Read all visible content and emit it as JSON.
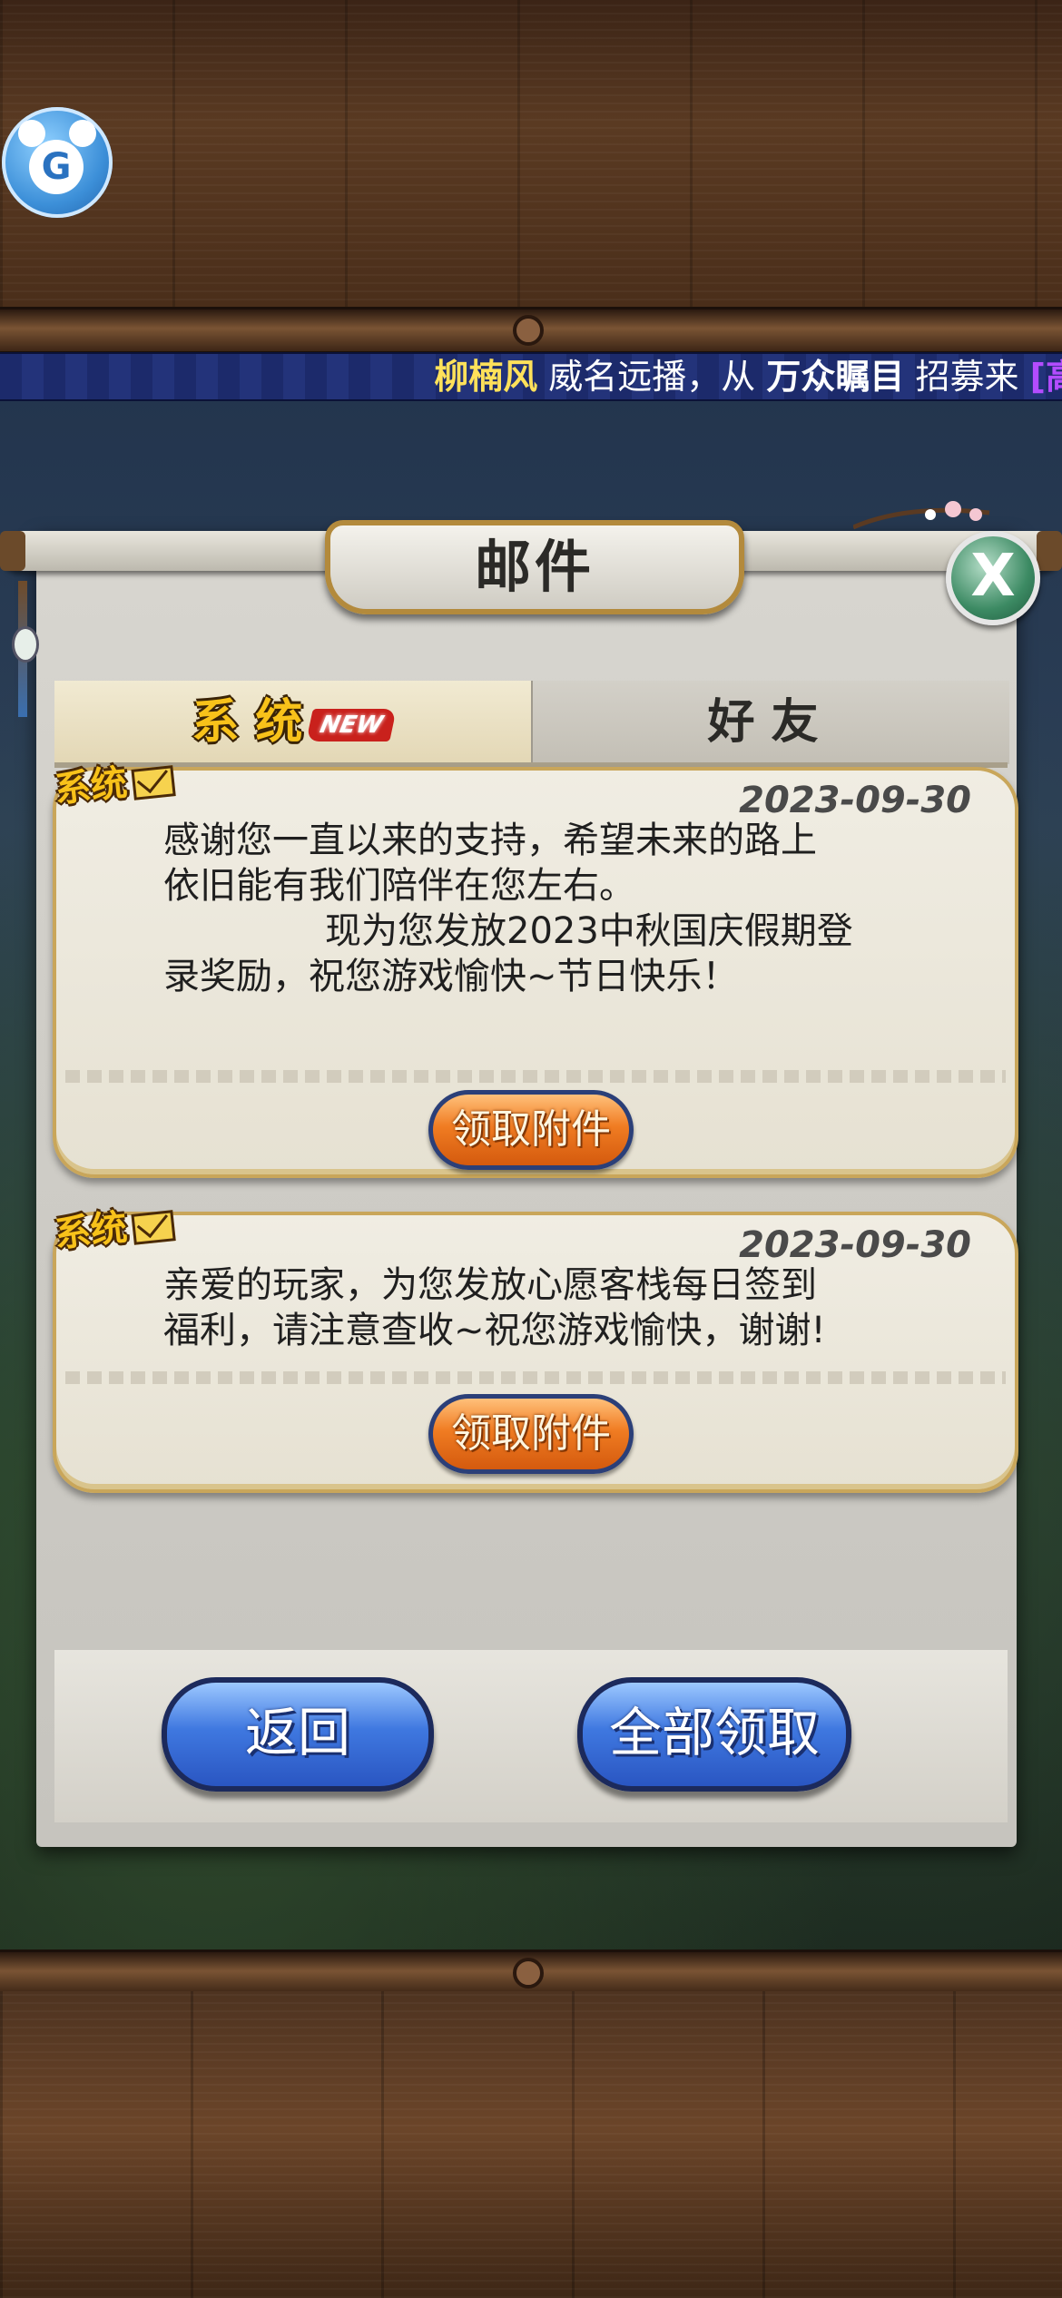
{
  "marquee": {
    "name": "柳楠风",
    "text1": "威名远播，从",
    "place": "万众瞩目",
    "text2": "招募来",
    "tail": "[高"
  },
  "logo": {
    "glyph": "G"
  },
  "window": {
    "title": "邮件",
    "close_glyph": "X"
  },
  "tabs": [
    {
      "label": "系统",
      "badge": "NEW",
      "active": true
    },
    {
      "label": "好友",
      "active": false
    }
  ],
  "mails": [
    {
      "tag": "系统",
      "date": "2023-09-30",
      "body": "感谢您一直以来的支持，希望未来的路上\n依旧能有我们陪伴在您左右。\n              现为您发放2023中秋国庆假期登\n录奖励，祝您游戏愉快~节日快乐！",
      "claim_label": "领取附件"
    },
    {
      "tag": "系统",
      "date": "2023-09-30",
      "body": "亲爱的玩家，为您发放心愿客栈每日签到\n福利，请注意查收~祝您游戏愉快，谢谢!",
      "claim_label": "领取附件"
    }
  ],
  "buttons": {
    "back": "返回",
    "claim_all": "全部领取"
  },
  "colors": {
    "gold": "#f8c21a",
    "claim_orange": "#f07c22",
    "button_blue": "#3f78e0",
    "marquee_blue": "#1c2a6b"
  }
}
